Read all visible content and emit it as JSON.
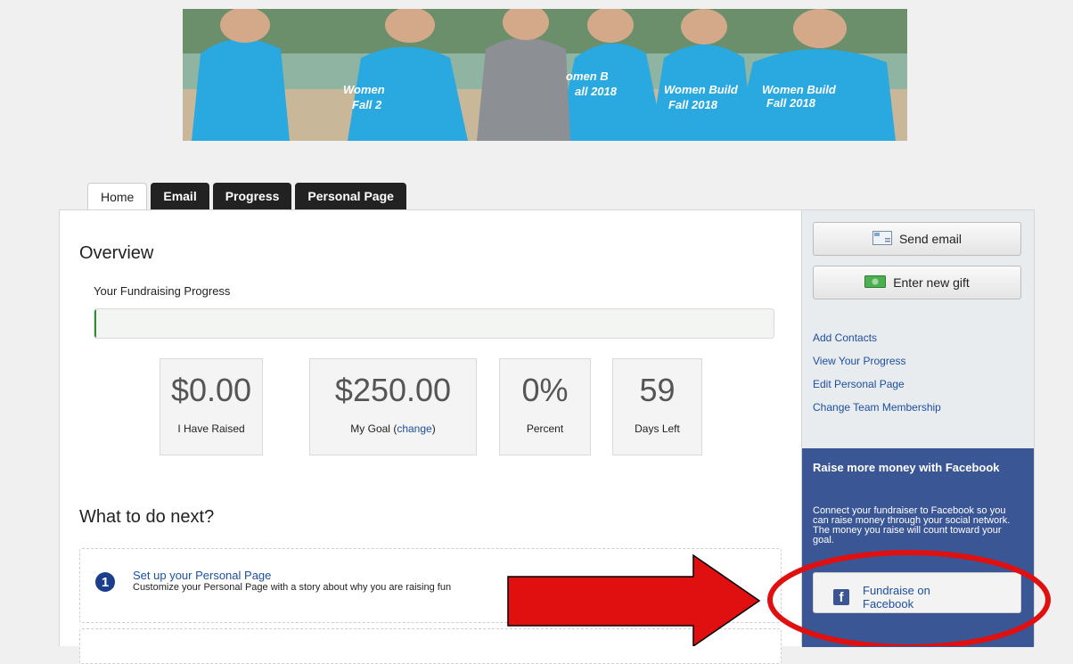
{
  "tabs": [
    {
      "label": "Home",
      "active": true
    },
    {
      "label": "Email",
      "active": false
    },
    {
      "label": "Progress",
      "active": false
    },
    {
      "label": "Personal Page",
      "active": false
    }
  ],
  "banner": {
    "shirt_text": "Women Build Fall 2018",
    "shirt_color": "#1ea5dc"
  },
  "overview": {
    "title": "Overview",
    "progress_label": "Your Fundraising Progress",
    "progress_fraction": 0,
    "progress_color": "#2e8b3a"
  },
  "stats": {
    "raised": {
      "value": "$0.00",
      "label": "I Have Raised"
    },
    "goal": {
      "value": "$250.00",
      "label": "My Goal",
      "link": "change"
    },
    "percent": {
      "value": "0%",
      "label": "Percent"
    },
    "days_left": {
      "value": "59",
      "label": "Days Left"
    }
  },
  "next": {
    "title": "What to do next?",
    "steps": [
      {
        "number": "1",
        "title": "Set up your Personal Page",
        "description": "Customize your Personal Page with a story about why you are raising fun"
      }
    ]
  },
  "sidebar": {
    "send_email": "Send email",
    "enter_gift": "Enter new gift",
    "links": [
      "Add Contacts",
      "View Your Progress",
      "Edit Personal Page",
      "Change Team Membership"
    ],
    "facebook": {
      "heading": "Raise more money with Facebook",
      "text": "Connect your fundraiser to Facebook so you can raise money through your social network. The money you raise will count toward your goal.",
      "button": "Fundraise on Facebook",
      "panel_color": "#3a5694"
    }
  },
  "annotation": {
    "arrow_color": "#e01010",
    "ellipse_color": "#e01010"
  }
}
